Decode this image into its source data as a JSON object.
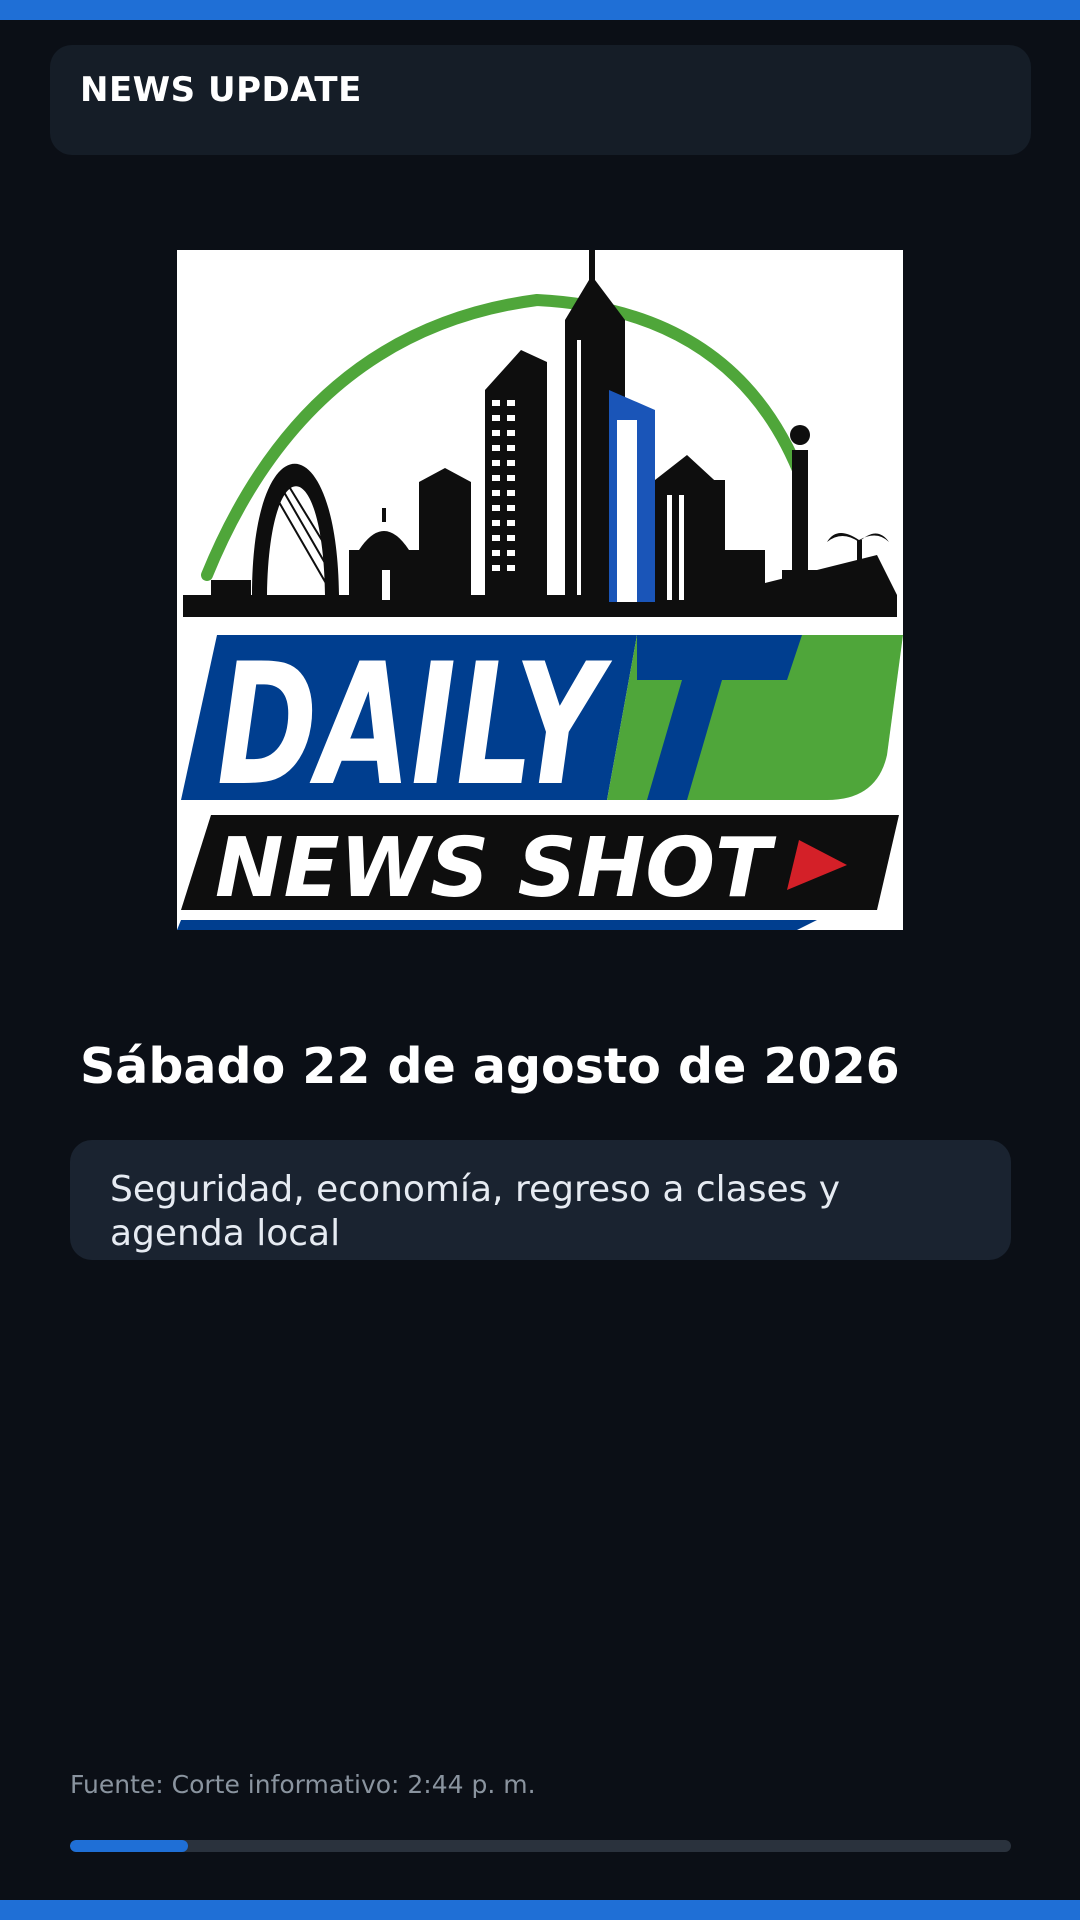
{
  "header": {
    "title": "NEWS UPDATE"
  },
  "logo": {
    "primary_text": "DAILY",
    "accent_text": "TJ",
    "tagline": "NEWS SHOT",
    "colors": {
      "blue": "#003e8f",
      "green": "#4fa63a",
      "black": "#0e0e0e",
      "red": "#d42028"
    }
  },
  "date_heading": "Sábado 22 de agosto de 2026",
  "summary": "Seguridad, economía, regreso a clases y agenda local",
  "source": "Fuente: Corte informativo: 2:44 p. m.",
  "progress": {
    "fraction": 0.125
  },
  "colors": {
    "background": "#0b0f16",
    "accent": "#1f6fd6",
    "card": "#151d27"
  }
}
